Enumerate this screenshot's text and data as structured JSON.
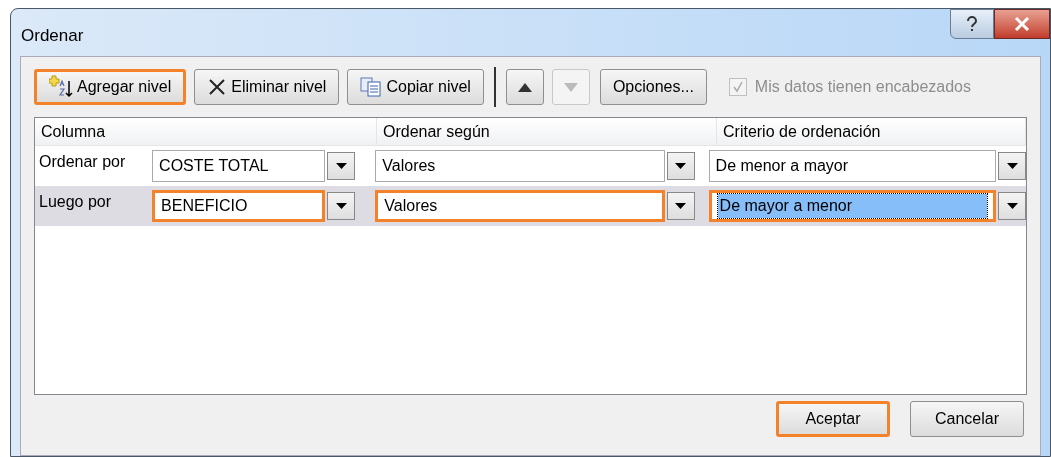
{
  "window": {
    "title": "Ordenar"
  },
  "toolbar": {
    "buttons": [
      {
        "kind": "add",
        "label": "Agregar nivel",
        "highlighted": true
      },
      {
        "kind": "delete",
        "label": "Eliminar nivel",
        "highlighted": false
      },
      {
        "kind": "copy",
        "label": "Copiar nivel",
        "highlighted": false
      }
    ],
    "move_up": {
      "disabled": false
    },
    "move_down": {
      "disabled": true
    },
    "options": {
      "label": "Opciones...",
      "highlighted": false
    },
    "headers_checkbox": {
      "label": "Mis datos tienen encabezados",
      "checked": true,
      "disabled": true
    }
  },
  "table": {
    "columns": [
      "Columna",
      "Ordenar según",
      "Criterio de ordenación"
    ],
    "rows": [
      {
        "label": "Ordenar por",
        "selected": false,
        "column": {
          "value": "COSTE TOTAL",
          "highlighted": false
        },
        "sort_on": {
          "value": "Valores",
          "highlighted": false
        },
        "order": {
          "value": "De menor a mayor",
          "highlighted": false,
          "focused": false
        }
      },
      {
        "label": "Luego por",
        "selected": true,
        "column": {
          "value": "BENEFICIO",
          "highlighted": true
        },
        "sort_on": {
          "value": "Valores",
          "highlighted": true
        },
        "order": {
          "value": "De mayor a menor",
          "highlighted": true,
          "focused": true
        }
      }
    ]
  },
  "footer": [
    {
      "label": "Aceptar",
      "highlighted": true
    },
    {
      "label": "Cancelar",
      "highlighted": false
    }
  ]
}
